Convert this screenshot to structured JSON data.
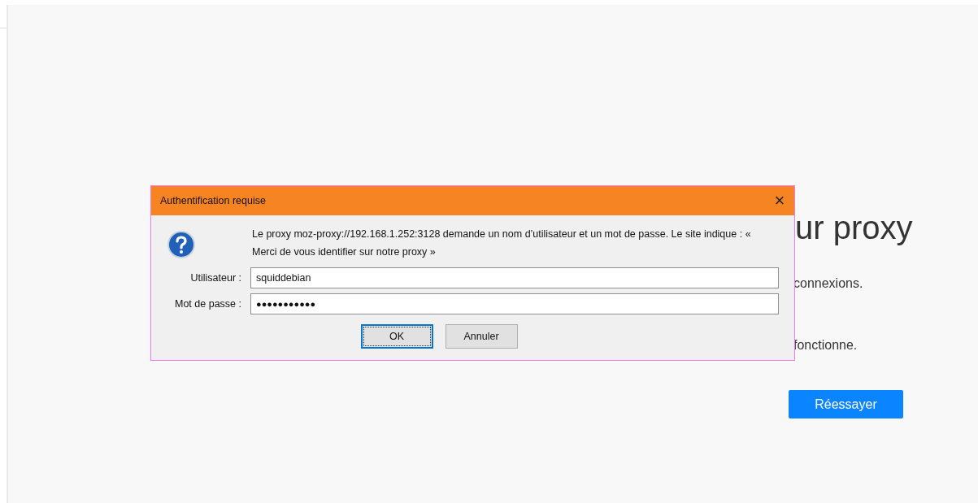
{
  "page": {
    "heading": "ur proxy",
    "lines": [
      "connexions.",
      "fonctionne."
    ],
    "retry_button": "Réessayer"
  },
  "dialog": {
    "title": "Authentification requise",
    "close": "×",
    "message": "Le proxy moz-proxy://192.168.1.252:3128 demande un nom d’utilisateur et un mot de passe. Le site indique : « Merci de vous identifier sur notre proxy »",
    "fields": [
      {
        "label": "Utilisateur :",
        "value": "squiddebian"
      },
      {
        "label": "Mot de passe :",
        "value": "●●●●●●●●●●●"
      }
    ],
    "buttons": [
      {
        "label": "OK",
        "focused": true
      },
      {
        "label": "Annuler",
        "focused": false
      }
    ]
  }
}
